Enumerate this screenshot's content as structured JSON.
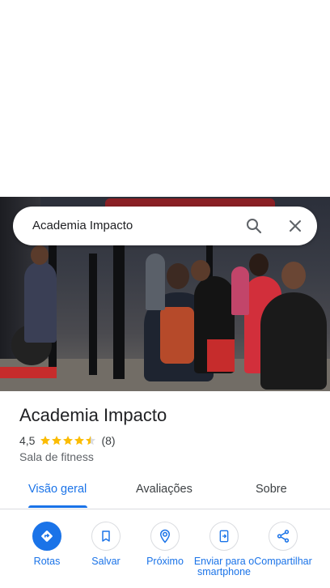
{
  "search": {
    "query": "Academia Impacto"
  },
  "place": {
    "name": "Academia Impacto",
    "rating": "4,5",
    "rating_value": 4.5,
    "review_count": "(8)",
    "category": "Sala de fitness"
  },
  "tabs": [
    {
      "label": "Visão geral",
      "active": true
    },
    {
      "label": "Avaliações",
      "active": false
    },
    {
      "label": "Sobre",
      "active": false
    }
  ],
  "actions": [
    {
      "label": "Rotas",
      "icon": "directions-icon"
    },
    {
      "label": "Salvar",
      "icon": "bookmark-icon"
    },
    {
      "label": "Próximo",
      "icon": "nearby-icon"
    },
    {
      "label": "Enviar para o smartphone",
      "icon": "send-to-phone-icon"
    },
    {
      "label": "Compartilhar",
      "icon": "share-icon"
    }
  ],
  "colors": {
    "accent": "#1a73e8",
    "star": "#fbbc04",
    "text": "#202124"
  }
}
